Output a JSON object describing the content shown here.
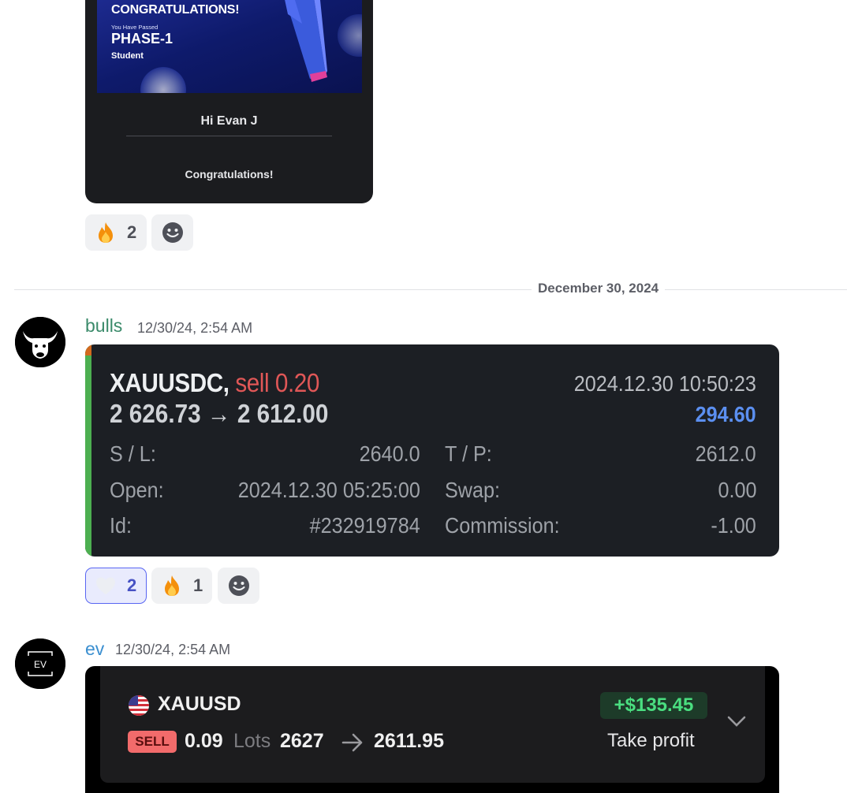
{
  "post1": {
    "banner_title": "CONGRATULATIONS!",
    "banner_sub": "You Have Passed",
    "banner_phase": "PHASE-1",
    "banner_role": "Student",
    "greeting": "Hi Evan J",
    "body": "Congratulations!",
    "reactions": [
      {
        "emoji": "fire-icon",
        "count": "2"
      }
    ]
  },
  "divider": {
    "date": "December 30, 2024"
  },
  "msg_bulls": {
    "username": "bulls",
    "username_color": "#3a8a6a",
    "timestamp": "12/30/24, 2:54 AM",
    "trade": {
      "symbol": "XAUUSDC,",
      "side": "sell 0.20",
      "price_from": "2 626.73",
      "arrow": "→",
      "price_to": "2 612.00",
      "datetime": "2024.12.30 10:50:23",
      "profit": "294.60",
      "sl_label": "S / L:",
      "sl_value": "2640.0",
      "tp_label": "T / P:",
      "tp_value": "2612.0",
      "open_label": "Open:",
      "open_value": "2024.12.30 05:25:00",
      "swap_label": "Swap:",
      "swap_value": "0.00",
      "id_label": "Id:",
      "id_value": "#232919784",
      "commission_label": "Commission:",
      "commission_value": "-1.00"
    },
    "reactions": [
      {
        "emoji": "heart-icon",
        "count": "2",
        "active": true
      },
      {
        "emoji": "fire-icon",
        "count": "1"
      }
    ]
  },
  "msg_ev": {
    "username": "ev",
    "username_color": "#3b8fd0",
    "avatar_text": "EV",
    "timestamp": "12/30/24, 2:54 AM",
    "trade": {
      "symbol": "XAUUSD",
      "pnl": "+$135.45",
      "side_badge": "SELL",
      "lots": "0.09",
      "lots_label": "Lots",
      "open_price": "2627",
      "close_price": "2611.95",
      "close_reason": "Take profit"
    }
  }
}
